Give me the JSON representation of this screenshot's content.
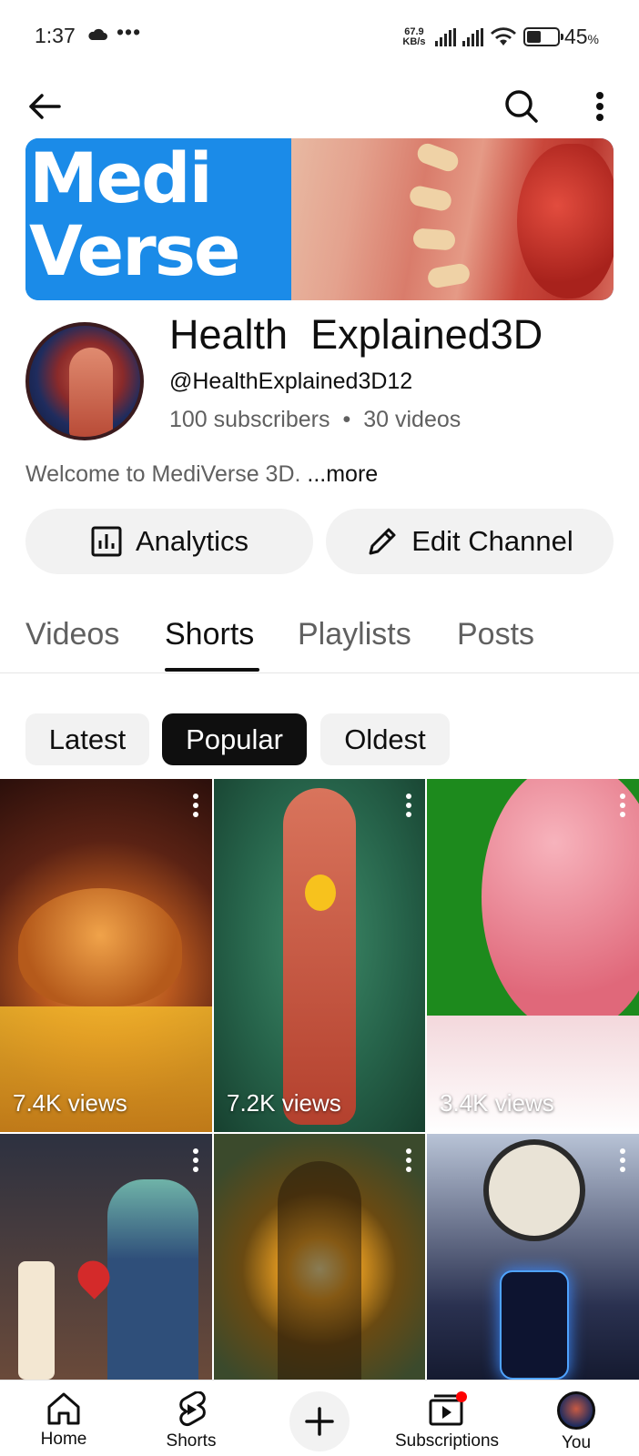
{
  "status_bar": {
    "time": "1:37",
    "dots": "•••",
    "speed_value": "67.9",
    "speed_unit": "KB/s",
    "battery": "45",
    "battery_unit": "%"
  },
  "topbar": {
    "back_icon": "arrow-left-icon",
    "search_icon": "search-icon",
    "more_icon": "more-vertical-icon"
  },
  "banner": {
    "line1": "Medi",
    "line2": "Verse"
  },
  "channel": {
    "name": "Health  Explained3D",
    "handle": "@HealthExplained3D12",
    "subscribers": "100 subscribers",
    "separator": "•",
    "videos": "30 videos",
    "description": "Welcome to MediVerse 3D. ",
    "more": "...more"
  },
  "actions": {
    "analytics": "Analytics",
    "edit_channel": "Edit Channel"
  },
  "tabs": [
    "Videos",
    "Shorts",
    "Playlists",
    "Posts"
  ],
  "active_tab": "Shorts",
  "chips": [
    "Latest",
    "Popular",
    "Oldest"
  ],
  "selected_chip": "Popular",
  "shorts": [
    {
      "views": "7.4K views"
    },
    {
      "views": "7.2K views"
    },
    {
      "views": "3.4K views"
    },
    {
      "views": ""
    },
    {
      "views": ""
    },
    {
      "views": ""
    }
  ],
  "bottom_nav": {
    "home": "Home",
    "shorts": "Shorts",
    "subscriptions": "Subscriptions",
    "you": "You"
  },
  "colors": {
    "accent_red": "#ff0000",
    "banner_blue": "#1b8be8",
    "text_primary": "#0f0f0f",
    "text_secondary": "#606060",
    "pill_bg": "#f2f2f2"
  }
}
